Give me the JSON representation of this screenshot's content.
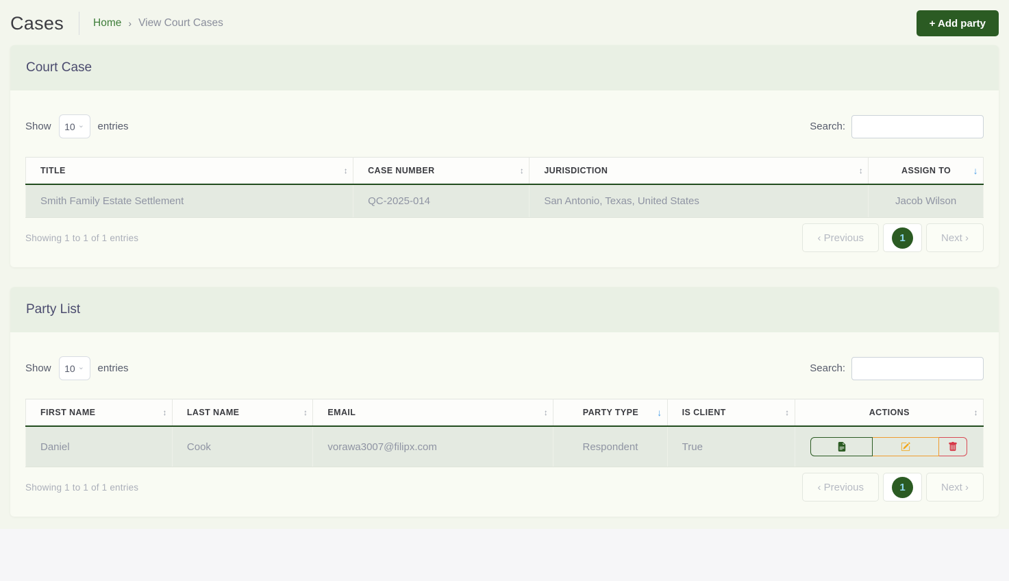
{
  "header": {
    "title": "Cases",
    "breadcrumb": {
      "home": "Home",
      "separator": "›",
      "current": "View Court Cases"
    },
    "add_party_label": "+ Add party"
  },
  "icons": {
    "sort_both": "↕",
    "sort_desc": "↓",
    "select_chevron": "⌄"
  },
  "colors": {
    "primary_green": "#2b5b23",
    "link_green": "#3c7c38",
    "panel_header_bg": "#e9f0e4",
    "row_highlight_bg": "#e4eae1",
    "sort_active_blue": "#4d9fe8",
    "edit_orange": "#f2a71b",
    "delete_red": "#d63a49",
    "page_number_color": "#8fd9f2"
  },
  "court_case": {
    "title": "Court Case",
    "show_label": "Show",
    "page_size": "10",
    "entries_label": "entries",
    "search_label": "Search:",
    "search_value": "",
    "columns": [
      {
        "label": "TITLE",
        "sort": "both"
      },
      {
        "label": "CASE NUMBER",
        "sort": "both"
      },
      {
        "label": "JURISDICTION",
        "sort": "both"
      },
      {
        "label": "ASSIGN TO",
        "sort": "desc"
      }
    ],
    "row": {
      "title": "Smith Family Estate Settlement",
      "case_number": "QC-2025-014",
      "jurisdiction": "San Antonio, Texas, United States",
      "assign_to": "Jacob Wilson"
    },
    "summary": "Showing 1 to 1 of 1 entries",
    "pagination": {
      "previous": "‹ Previous",
      "page": "1",
      "next": "Next ›"
    }
  },
  "party_list": {
    "title": "Party List",
    "show_label": "Show",
    "page_size": "10",
    "entries_label": "entries",
    "search_label": "Search:",
    "search_value": "",
    "columns": [
      {
        "label": "FIRST NAME",
        "sort": "both"
      },
      {
        "label": "LAST NAME",
        "sort": "both"
      },
      {
        "label": "EMAIL",
        "sort": "both"
      },
      {
        "label": "PARTY TYPE",
        "sort": "desc"
      },
      {
        "label": "IS CLIENT",
        "sort": "both"
      },
      {
        "label": "ACTIONS",
        "sort": "both"
      }
    ],
    "row": {
      "first_name": "Daniel",
      "last_name": "Cook",
      "email": "vorawa3007@filipx.com",
      "party_type": "Respondent",
      "is_client": "True"
    },
    "summary": "Showing 1 to 1 of 1 entries",
    "pagination": {
      "previous": "‹ Previous",
      "page": "1",
      "next": "Next ›"
    }
  }
}
